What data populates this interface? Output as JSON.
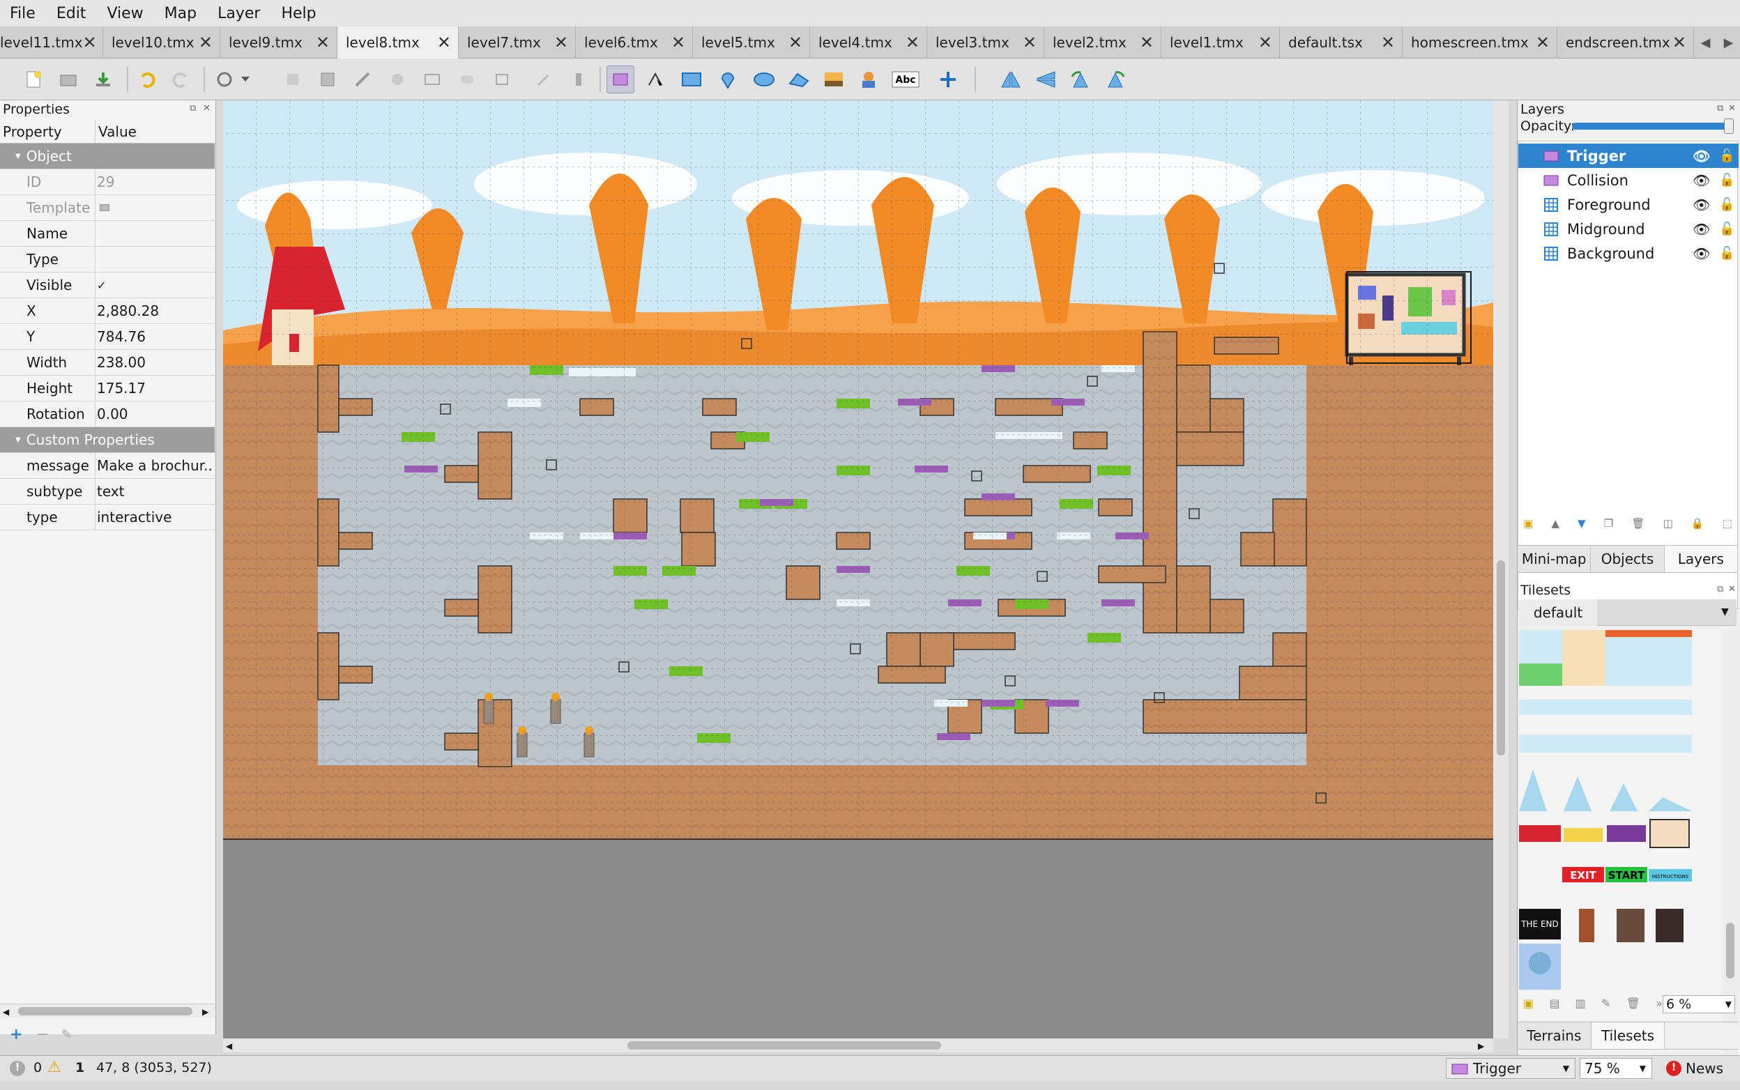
{
  "menu": [
    "File",
    "Edit",
    "View",
    "Map",
    "Layer",
    "Help"
  ],
  "tabs": [
    "level11.tmx",
    "level10.tmx",
    "level9.tmx",
    "level8.tmx",
    "level7.tmx",
    "level6.tmx",
    "level5.tmx",
    "level4.tmx",
    "level3.tmx",
    "level2.tmx",
    "level1.tmx",
    "default.tsx",
    "homescreen.tmx",
    "endscreen.tmx"
  ],
  "active_tab": "level8.tmx",
  "properties": {
    "title": "Properties",
    "col_property": "Property",
    "col_value": "Value",
    "object_header": "Object",
    "rows": [
      {
        "key": "ID",
        "value": "29",
        "dim": true
      },
      {
        "key": "Template",
        "value": "",
        "dim": true
      },
      {
        "key": "Name",
        "value": ""
      },
      {
        "key": "Type",
        "value": ""
      },
      {
        "key": "Visible",
        "value": "✓"
      },
      {
        "key": "X",
        "value": "2,880.28"
      },
      {
        "key": "Y",
        "value": "784.76"
      },
      {
        "key": "Width",
        "value": "238.00"
      },
      {
        "key": "Height",
        "value": "175.17"
      },
      {
        "key": "Rotation",
        "value": "0.00"
      }
    ],
    "custom_header": "Custom Properties",
    "custom_rows": [
      {
        "key": "message",
        "value": "Make a brochur..."
      },
      {
        "key": "subtype",
        "value": "text"
      },
      {
        "key": "type",
        "value": "interactive"
      }
    ]
  },
  "layers_panel": {
    "title": "Layers",
    "opacity_label": "Opacity:",
    "opacity": 1.0,
    "layers": [
      {
        "name": "Trigger",
        "kind": "object",
        "selected": true
      },
      {
        "name": "Collision",
        "kind": "object",
        "selected": false
      },
      {
        "name": "Foreground",
        "kind": "tile",
        "selected": false
      },
      {
        "name": "Midground",
        "kind": "tile",
        "selected": false
      },
      {
        "name": "Background",
        "kind": "tile",
        "selected": false
      }
    ],
    "tabs": [
      "Mini-map",
      "Objects",
      "Layers"
    ],
    "active_tab": "Layers"
  },
  "tilesets_panel": {
    "title": "Tilesets",
    "current": "default",
    "tile_text": [
      "EXIT",
      "START",
      "INSTRUCTIONS",
      "THE END"
    ],
    "zoom": "6 %",
    "tabs": [
      "Terrains",
      "Tilesets"
    ],
    "active_tab": "Tilesets"
  },
  "status": {
    "errors": "0",
    "warnings": "1",
    "coords": "47, 8 (3053, 527)",
    "layer": "Trigger",
    "zoom": "75 %",
    "news": "News"
  },
  "colors": {
    "accent": "#2f84d0",
    "sky": "#cfe9f6",
    "autumn_orange": "#f08a2c",
    "dirt": "#c48a5c",
    "water": "#bcc6cc",
    "grass": "#6fbf2a",
    "purple": "#9a5fb5"
  }
}
